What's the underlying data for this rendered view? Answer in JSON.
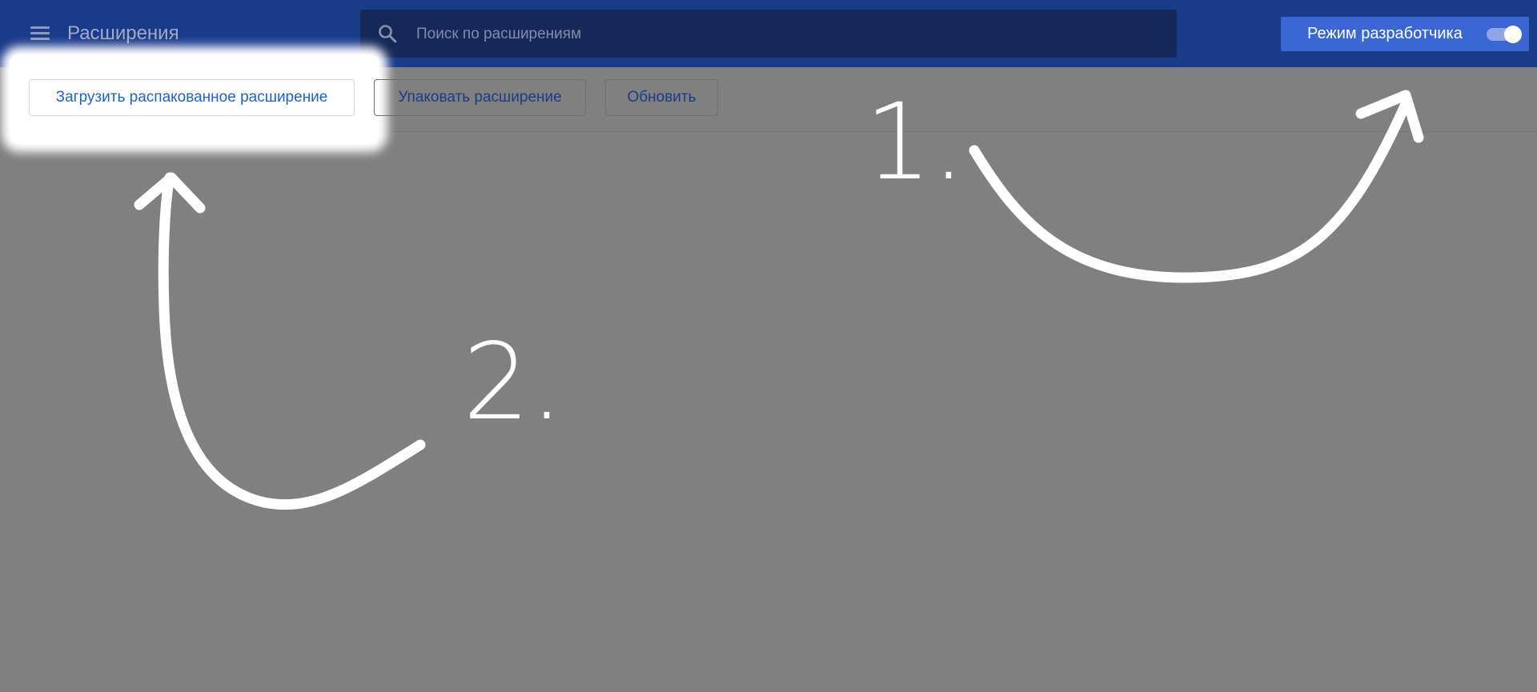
{
  "header": {
    "menu_icon": "hamburger-menu-icon",
    "title": "Расширения",
    "search": {
      "icon": "search-icon",
      "placeholder": "Поиск по расширениям",
      "value": ""
    },
    "developer_mode": {
      "label": "Режим разработчика",
      "enabled": true
    }
  },
  "toolbar": {
    "load_unpacked": "Загрузить распакованное расширение",
    "pack_extension": "Упаковать расширение",
    "update": "Обновить"
  },
  "annotations": {
    "step1": "1.",
    "step2": "2."
  },
  "colors": {
    "header_bg": "#1a3b8a",
    "overlay": "#808080",
    "accent": "#3b67d4",
    "button_text": "#1a63d2"
  }
}
